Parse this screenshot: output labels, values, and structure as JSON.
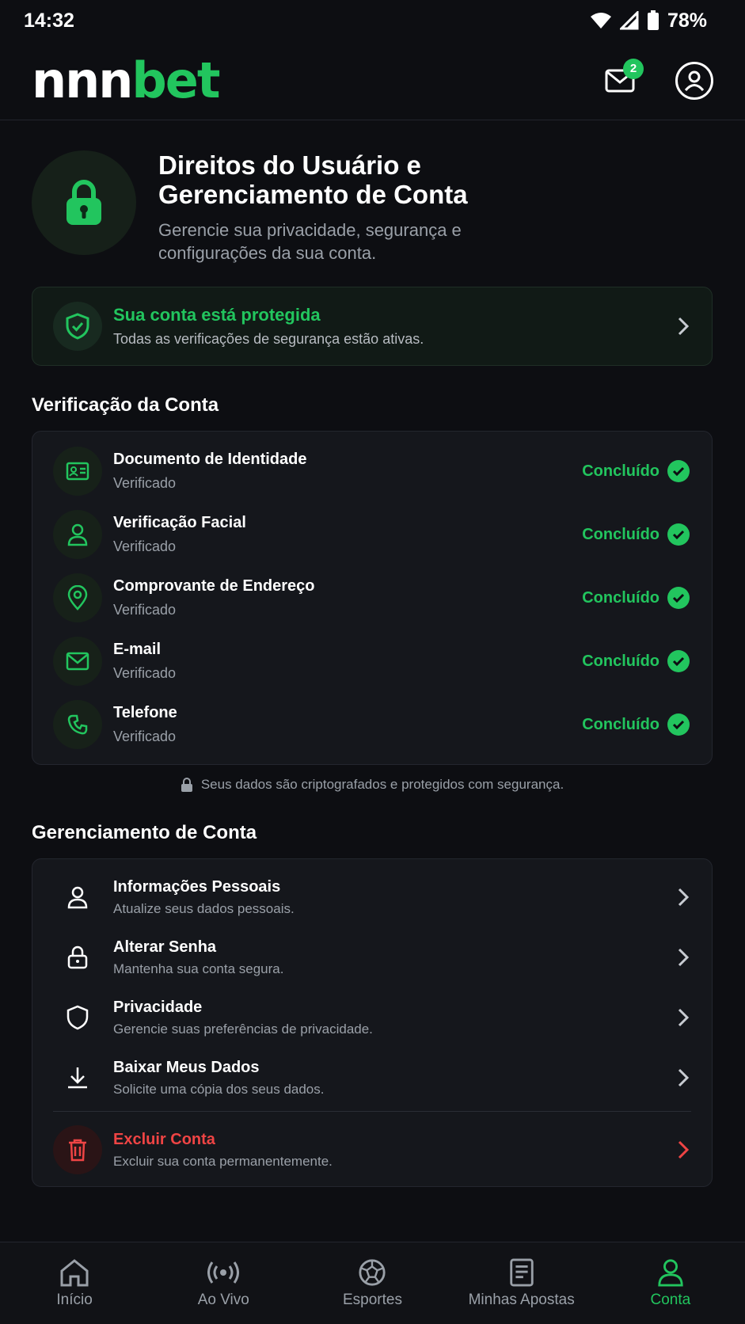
{
  "status_bar": {
    "time": "14:32",
    "battery": "78%"
  },
  "header": {
    "logo_white": "nnn",
    "logo_green": "bet",
    "mail_badge": "2"
  },
  "hero": {
    "title_line1": "Direitos do Usuário e",
    "title_line2": "Gerenciamento de Conta",
    "subtitle": "Gerencie sua privacidade, segurança e configurações da sua conta."
  },
  "protection": {
    "title": "Sua conta está protegida",
    "subtitle": "Todas as verificações de segurança estão ativas."
  },
  "verification": {
    "section_title": "Verificação da Conta",
    "items": [
      {
        "name": "Documento de Identidade",
        "status": "Verificado",
        "result": "Concluído",
        "icon": "id-card-icon"
      },
      {
        "name": "Verificação Facial",
        "status": "Verificado",
        "result": "Concluído",
        "icon": "user-icon"
      },
      {
        "name": "Comprovante de Endereço",
        "status": "Verificado",
        "result": "Concluído",
        "icon": "map-pin-icon"
      },
      {
        "name": "E-mail",
        "status": "Verificado",
        "result": "Concluído",
        "icon": "mail-icon"
      },
      {
        "name": "Telefone",
        "status": "Verificado",
        "result": "Concluído",
        "icon": "phone-icon"
      }
    ],
    "secure_note": "Seus dados são criptografados e protegidos com segurança."
  },
  "management": {
    "section_title": "Gerenciamento de Conta",
    "items": [
      {
        "name": "Informações Pessoais",
        "sub": "Atualize seus dados pessoais.",
        "icon": "user-icon"
      },
      {
        "name": "Alterar Senha",
        "sub": "Mantenha sua conta segura.",
        "icon": "lock-icon"
      },
      {
        "name": "Privacidade",
        "sub": "Gerencie suas preferências de privacidade.",
        "icon": "shield-icon"
      },
      {
        "name": "Baixar Meus Dados",
        "sub": "Solicite uma cópia dos seus dados.",
        "icon": "download-icon"
      }
    ],
    "danger": {
      "name": "Excluir Conta",
      "sub": "Excluir sua conta permanentemente.",
      "icon": "trash-icon"
    }
  },
  "bottom_nav": [
    {
      "label": "Início",
      "icon": "home-icon"
    },
    {
      "label": "Ao Vivo",
      "icon": "live-icon"
    },
    {
      "label": "Esportes",
      "icon": "ball-icon"
    },
    {
      "label": "Minhas Apostas",
      "icon": "ticket-icon"
    },
    {
      "label": "Conta",
      "icon": "account-icon",
      "active": true
    }
  ],
  "colors": {
    "accent": "#22c55e",
    "danger": "#ef4444",
    "background": "#0d0e12"
  }
}
